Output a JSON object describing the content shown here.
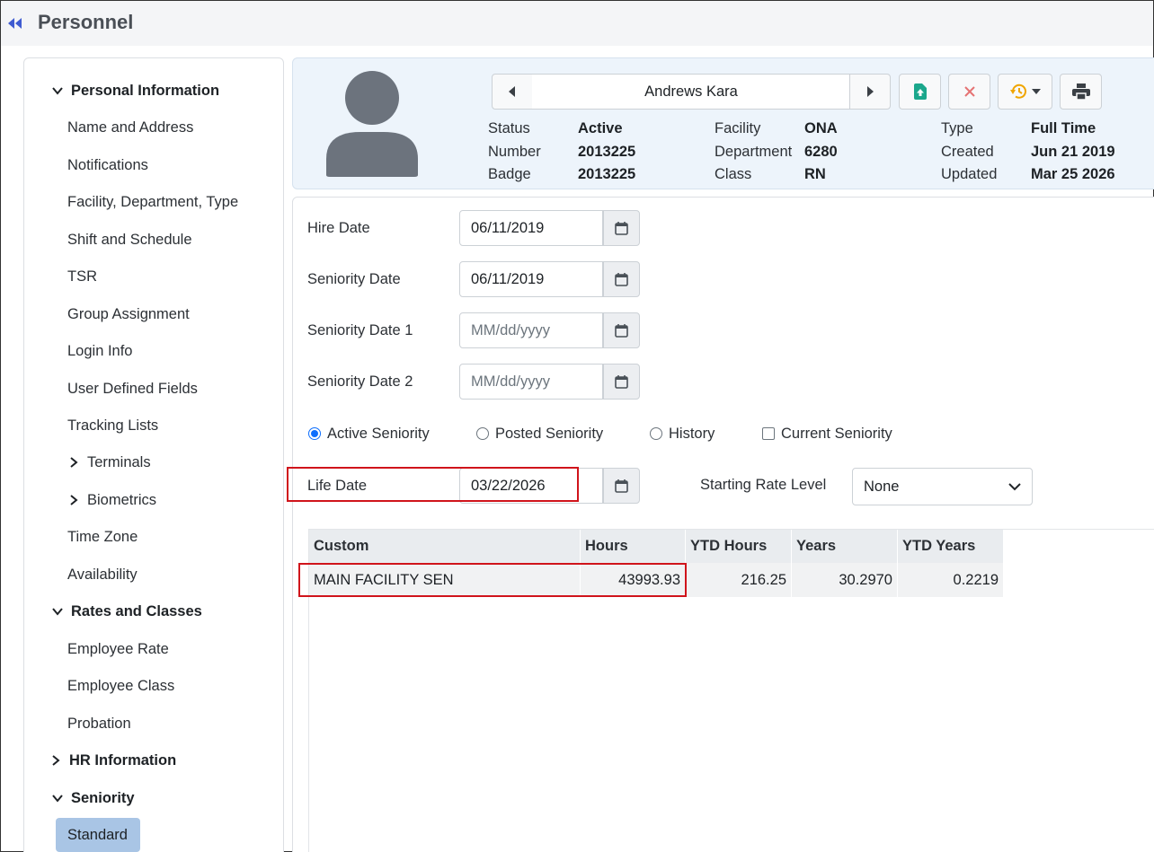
{
  "page": {
    "title": "Personnel"
  },
  "sidebar": {
    "personal_information": {
      "label": "Personal Information",
      "items": [
        "Name and Address",
        "Notifications",
        "Facility, Department, Type",
        "Shift and Schedule",
        "TSR",
        "Group Assignment",
        "Login Info",
        "User Defined Fields",
        "Tracking Lists"
      ],
      "terminals": "Terminals",
      "biometrics": "Biometrics",
      "items2": [
        "Time Zone",
        "Availability"
      ]
    },
    "rates_and_classes": {
      "label": "Rates and Classes",
      "items": [
        "Employee Rate",
        "Employee Class",
        "Probation"
      ]
    },
    "hr_information": {
      "label": "HR Information"
    },
    "seniority": {
      "label": "Seniority",
      "active_item": "Standard"
    }
  },
  "employee": {
    "name": "Andrews Kara",
    "status_label": "Status",
    "status": "Active",
    "number_label": "Number",
    "number": "2013225",
    "badge_label": "Badge",
    "badge": "2013225",
    "facility_label": "Facility",
    "facility": "ONA",
    "department_label": "Department",
    "department": "6280",
    "class_label": "Class",
    "class": "RN",
    "type_label": "Type",
    "type": "Full Time",
    "created_label": "Created",
    "created": "Jun 21 2019",
    "updated_label": "Updated",
    "updated": "Mar 25 2026"
  },
  "form": {
    "hire_date": {
      "label": "Hire Date",
      "value": "06/11/2019",
      "placeholder": "MM/dd/yyyy"
    },
    "seniority_date": {
      "label": "Seniority Date",
      "value": "06/11/2019",
      "placeholder": "MM/dd/yyyy"
    },
    "seniority_date_1": {
      "label": "Seniority Date 1",
      "value": "",
      "placeholder": "MM/dd/yyyy"
    },
    "seniority_date_2": {
      "label": "Seniority Date 2",
      "value": "",
      "placeholder": "MM/dd/yyyy"
    },
    "radios": {
      "active": "Active Seniority",
      "posted": "Posted Seniority",
      "history": "History"
    },
    "current_seniority": "Current Seniority",
    "life_date": {
      "label": "Life Date",
      "value": "03/22/2026"
    },
    "starting_rate_level": {
      "label": "Starting Rate Level",
      "value": "None"
    }
  },
  "table": {
    "headers": [
      "Custom",
      "Hours",
      "YTD Hours",
      "Years",
      "YTD Years"
    ],
    "rows": [
      [
        "MAIN FACILITY SEN",
        "43993.93",
        "216.25",
        "30.2970",
        "0.2219"
      ]
    ]
  },
  "colors": {
    "accent": "#0d6efd",
    "highlight": "#d0141b",
    "header_bg": "#edf4fb",
    "active_nav": "#a9c5e5",
    "upload_green": "#1aa78c",
    "delete_red": "#e57373",
    "history_amber": "#f0a500"
  }
}
